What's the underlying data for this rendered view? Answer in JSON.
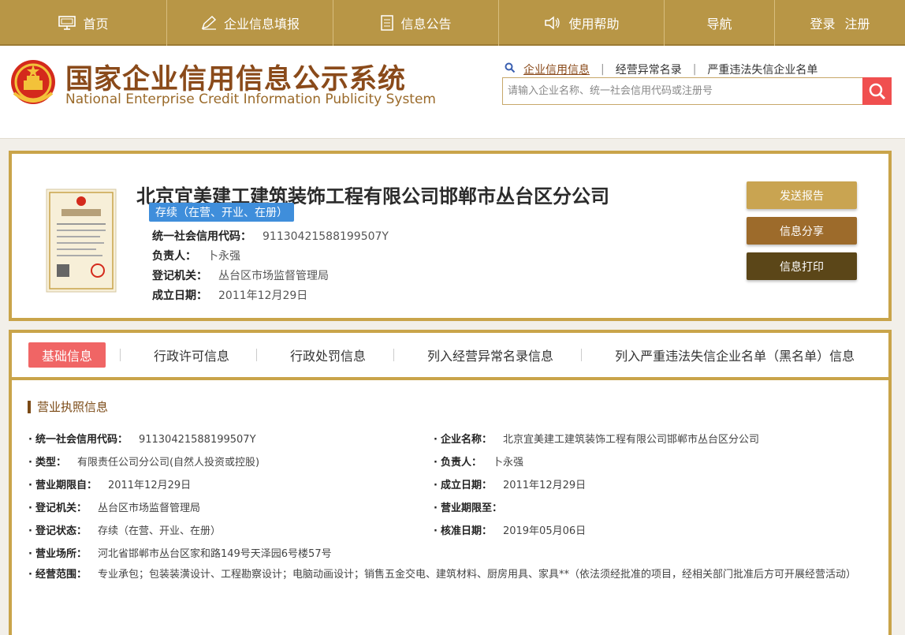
{
  "nav": {
    "home": "首页",
    "fill": "企业信息填报",
    "notice": "信息公告",
    "help": "使用帮助",
    "guide": "导航",
    "login": "登录",
    "register": "注册"
  },
  "header": {
    "title_cn": "国家企业信用信息公示系统",
    "title_en": "National Enterprise Credit Information Publicity System",
    "search_tabs": [
      "企业信用信息",
      "经营异常名录",
      "严重违法失信企业名单"
    ],
    "search_placeholder": "请输入企业名称、统一社会信用代码或注册号"
  },
  "company": {
    "name": "北京宜美建工建筑装饰工程有限公司邯郸市丛台区分公司",
    "status": "存续（在营、开业、在册）",
    "credit_code_label": "统一社会信用代码：",
    "credit_code": "91130421588199507Y",
    "person_label": "负责人：",
    "person": "卜永强",
    "authority_label": "登记机关：",
    "authority": "丛台区市场监督管理局",
    "established_label": "成立日期：",
    "established": "2011年12月29日",
    "buttons": [
      "发送报告",
      "信息分享",
      "信息打印"
    ]
  },
  "tabs": [
    "基础信息",
    "行政许可信息",
    "行政处罚信息",
    "列入经营异常名录信息",
    "列入严重违法失信企业名单（黑名单）信息"
  ],
  "section_title": "营业执照信息",
  "details": {
    "left": [
      {
        "label": "统一社会信用代码：",
        "value": "91130421588199507Y"
      },
      {
        "label": "类型：",
        "value": "有限责任公司分公司(自然人投资或控股)"
      },
      {
        "label": "营业期限自：",
        "value": "2011年12月29日"
      },
      {
        "label": "登记机关：",
        "value": "丛台区市场监督管理局"
      },
      {
        "label": "登记状态：",
        "value": "存续（在营、开业、在册）"
      },
      {
        "label": "营业场所：",
        "value": "河北省邯郸市丛台区家和路149号天泽园6号楼57号"
      }
    ],
    "right": [
      {
        "label": "企业名称：",
        "value": "北京宜美建工建筑装饰工程有限公司邯郸市丛台区分公司"
      },
      {
        "label": "负责人：",
        "value": "卜永强"
      },
      {
        "label": "成立日期：",
        "value": "2011年12月29日"
      },
      {
        "label": "营业期限至：",
        "value": ""
      },
      {
        "label": "核准日期：",
        "value": "2019年05月06日"
      }
    ],
    "scope_label": "经营范围：",
    "scope_value": "专业承包；包装装潢设计、工程勘察设计；电脑动画设计；销售五金交电、建筑材料、厨房用具、家具**（依法须经批准的项目，经相关部门批准后方可开展经营活动）"
  },
  "colors": {
    "nav_bg": "#b89646",
    "border_gold": "#c9a44a",
    "title_brown": "#8a4a1a",
    "status_blue": "#3f8edb",
    "active_tab": "#f06565",
    "search_btn": "#f04f4f"
  },
  "icons": [
    "monitor-icon",
    "pen-icon",
    "document-icon",
    "speaker-icon",
    "search-icon",
    "national-emblem",
    "business-license-image"
  ]
}
